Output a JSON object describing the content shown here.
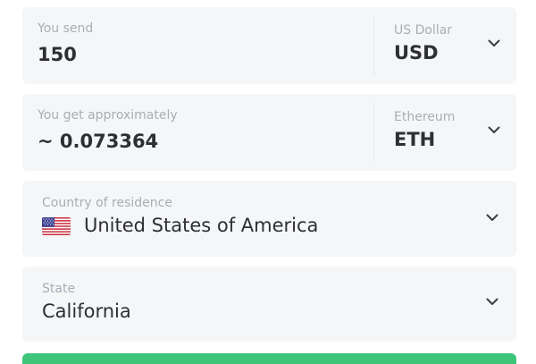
{
  "send": {
    "label": "You send",
    "amount": "150",
    "currency_name": "US Dollar",
    "currency_code": "USD"
  },
  "get": {
    "label": "You get approximately",
    "amount": "~ 0.073364",
    "currency_name": "Ethereum",
    "currency_code": "ETH"
  },
  "country": {
    "label": "Country of residence",
    "value": "United States of America",
    "flag_icon": "us-flag-icon"
  },
  "state": {
    "label": "State",
    "value": "California"
  },
  "icons": {
    "dropdown": "chevron-down-icon"
  },
  "colors": {
    "field_bg": "#f5f6f8",
    "label": "#a9adb5",
    "text": "#2d2f33",
    "accent_green": "#3ec57a"
  }
}
